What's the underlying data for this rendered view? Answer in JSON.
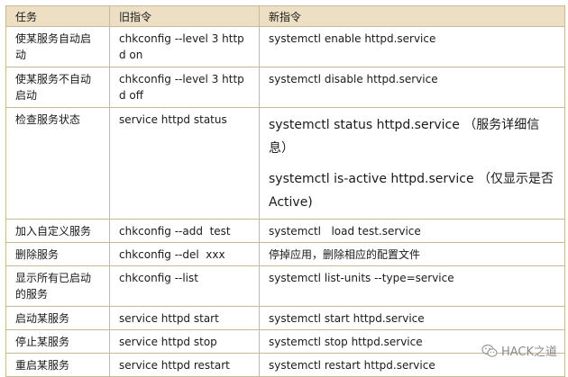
{
  "table": {
    "headers": [
      "任务",
      "旧指令",
      "新指令"
    ],
    "rows": [
      {
        "task": "使某服务自动启动",
        "old": "chkconfig --level 3 httpd on",
        "new": [
          "systemctl enable httpd.service"
        ]
      },
      {
        "task": "使某服务不自动启动",
        "old": "chkconfig --level 3 httpd off",
        "new": [
          "systemctl disable httpd.service"
        ]
      },
      {
        "task": "检查服务状态",
        "old": "service httpd status",
        "new": [
          "systemctl status httpd.service （服务详细信息）",
          "systemctl is-active httpd.service （仅显示是否 Active)"
        ]
      },
      {
        "task": "加入自定义服务",
        "old": "chkconfig --add  test",
        "new": [
          "systemctl   load test.service"
        ]
      },
      {
        "task": "删除服务",
        "old": "chkconfig --del  xxx",
        "new": [
          "停掉应用，删除相应的配置文件"
        ]
      },
      {
        "task": "显示所有已启动的服务",
        "old": "chkconfig --list",
        "new": [
          "systemctl list-units --type=service"
        ]
      },
      {
        "task": "启动某服务",
        "old": "service httpd start",
        "new": [
          "systemctl start httpd.service"
        ]
      },
      {
        "task": "停止某服务",
        "old": "service httpd stop",
        "new": [
          "systemctl stop httpd.service"
        ]
      },
      {
        "task": "重启某服务",
        "old": "service httpd restart",
        "new": [
          "systemctl restart httpd.service"
        ]
      }
    ]
  },
  "watermark": {
    "text": "HACK之道",
    "icon": "wechat-icon"
  }
}
